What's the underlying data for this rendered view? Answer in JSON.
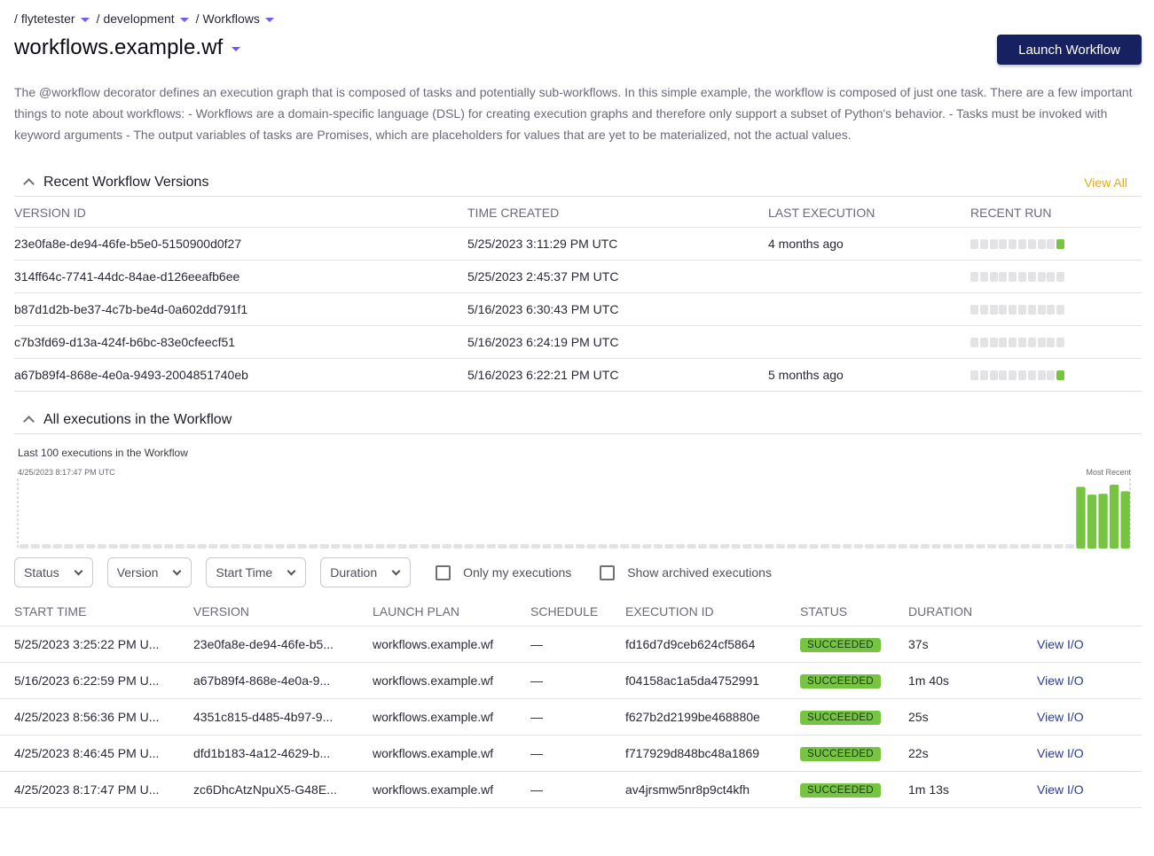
{
  "breadcrumb": [
    {
      "label": "flytetester"
    },
    {
      "label": "development"
    },
    {
      "label": "Workflows"
    }
  ],
  "header": {
    "title": "workflows.example.wf",
    "launch_label": "Launch Workflow"
  },
  "description": "The @workflow decorator defines an execution graph that is composed of tasks and potentially sub-workflows. In this simple example, the workflow is composed of just one task. There are a few important things to note about workflows: - Workflows are a domain-specific language (DSL) for creating execution graphs and therefore only support a subset of Python's behavior. - Tasks must be invoked with keyword arguments - The output variables of tasks are Promises, which are placeholders for values that are yet to be materialized, not the actual values.",
  "colors": {
    "accent": "#6b5cf0",
    "primary_button": "#17215f",
    "success": "#77c443",
    "view_all": "#e9a81b",
    "link": "#2a3b8f"
  },
  "versions": {
    "title": "Recent Workflow Versions",
    "view_all_label": "View All",
    "columns": [
      "VERSION ID",
      "TIME CREATED",
      "LAST EXECUTION",
      "RECENT RUN"
    ],
    "rows": [
      {
        "id": "23e0fa8e-de94-46fe-b5e0-5150900d0f27",
        "created": "5/25/2023 3:11:29 PM UTC",
        "last_execution": "4 months ago",
        "recent_run": [
          "none",
          "none",
          "none",
          "none",
          "none",
          "none",
          "none",
          "none",
          "none",
          "succeeded"
        ]
      },
      {
        "id": "314ff64c-7741-44dc-84ae-d126eeafb6ee",
        "created": "5/25/2023 2:45:37 PM UTC",
        "last_execution": "",
        "recent_run": [
          "none",
          "none",
          "none",
          "none",
          "none",
          "none",
          "none",
          "none",
          "none",
          "none"
        ]
      },
      {
        "id": "b87d1d2b-be37-4c7b-be4d-0a602dd791f1",
        "created": "5/16/2023 6:30:43 PM UTC",
        "last_execution": "",
        "recent_run": [
          "none",
          "none",
          "none",
          "none",
          "none",
          "none",
          "none",
          "none",
          "none",
          "none"
        ]
      },
      {
        "id": "c7b3fd69-d13a-424f-b6bc-83e0cfeecf51",
        "created": "5/16/2023 6:24:19 PM UTC",
        "last_execution": "",
        "recent_run": [
          "none",
          "none",
          "none",
          "none",
          "none",
          "none",
          "none",
          "none",
          "none",
          "none"
        ]
      },
      {
        "id": "a67b89f4-868e-4e0a-9493-2004851740eb",
        "created": "5/16/2023 6:22:21 PM UTC",
        "last_execution": "5 months ago",
        "recent_run": [
          "none",
          "none",
          "none",
          "none",
          "none",
          "none",
          "none",
          "none",
          "none",
          "succeeded"
        ]
      }
    ]
  },
  "executions_section": {
    "title": "All executions in the Workflow"
  },
  "chart_data": {
    "type": "bar",
    "title": "Last 100 executions in the Workflow",
    "start_label": "4/25/2023 8:17:47 PM UTC",
    "end_label": "Most Recent",
    "total_slots": 100,
    "empty_slots": 95,
    "xlabel": "",
    "ylabel": "",
    "categories": [
      "4/25/2023 8:17:47 PM",
      "4/25/2023 8:46:45 PM",
      "4/25/2023 8:56:36 PM",
      "5/16/2023 6:22:59 PM",
      "5/25/2023 3:25:22 PM"
    ],
    "values": [
      73,
      22,
      25,
      100,
      37
    ],
    "unit": "seconds",
    "status": [
      "succeeded",
      "succeeded",
      "succeeded",
      "succeeded",
      "succeeded"
    ]
  },
  "filters": {
    "dropdowns": [
      {
        "label": "Status"
      },
      {
        "label": "Version"
      },
      {
        "label": "Start Time"
      },
      {
        "label": "Duration"
      }
    ],
    "checkboxes": [
      {
        "label": "Only my executions",
        "checked": false
      },
      {
        "label": "Show archived executions",
        "checked": false
      }
    ]
  },
  "executions": {
    "columns": [
      "START TIME",
      "VERSION",
      "LAUNCH PLAN",
      "SCHEDULE",
      "EXECUTION ID",
      "STATUS",
      "DURATION",
      ""
    ],
    "rows": [
      {
        "start": "5/25/2023 3:25:22 PM U...",
        "version": "23e0fa8e-de94-46fe-b5...",
        "launch_plan": "workflows.example.wf",
        "schedule": "—",
        "exec_id": "fd16d7d9ceb624cf5864",
        "status": "SUCCEEDED",
        "duration": "37s",
        "action": "View I/O"
      },
      {
        "start": "5/16/2023 6:22:59 PM U...",
        "version": "a67b89f4-868e-4e0a-9...",
        "launch_plan": "workflows.example.wf",
        "schedule": "—",
        "exec_id": "f04158ac1a5da4752991",
        "status": "SUCCEEDED",
        "duration": "1m 40s",
        "action": "View I/O"
      },
      {
        "start": "4/25/2023 8:56:36 PM U...",
        "version": "4351c815-d485-4b97-9...",
        "launch_plan": "workflows.example.wf",
        "schedule": "—",
        "exec_id": "f627b2d2199be468880e",
        "status": "SUCCEEDED",
        "duration": "25s",
        "action": "View I/O"
      },
      {
        "start": "4/25/2023 8:46:45 PM U...",
        "version": "dfd1b183-4a12-4629-b...",
        "launch_plan": "workflows.example.wf",
        "schedule": "—",
        "exec_id": "f717929d848bc48a1869",
        "status": "SUCCEEDED",
        "duration": "22s",
        "action": "View I/O"
      },
      {
        "start": "4/25/2023 8:17:47 PM U...",
        "version": "zc6DhcAtzNpuX5-G48E...",
        "launch_plan": "workflows.example.wf",
        "schedule": "—",
        "exec_id": "av4jrsmw5nr8p9ct4kfh",
        "status": "SUCCEEDED",
        "duration": "1m 13s",
        "action": "View I/O"
      }
    ]
  }
}
